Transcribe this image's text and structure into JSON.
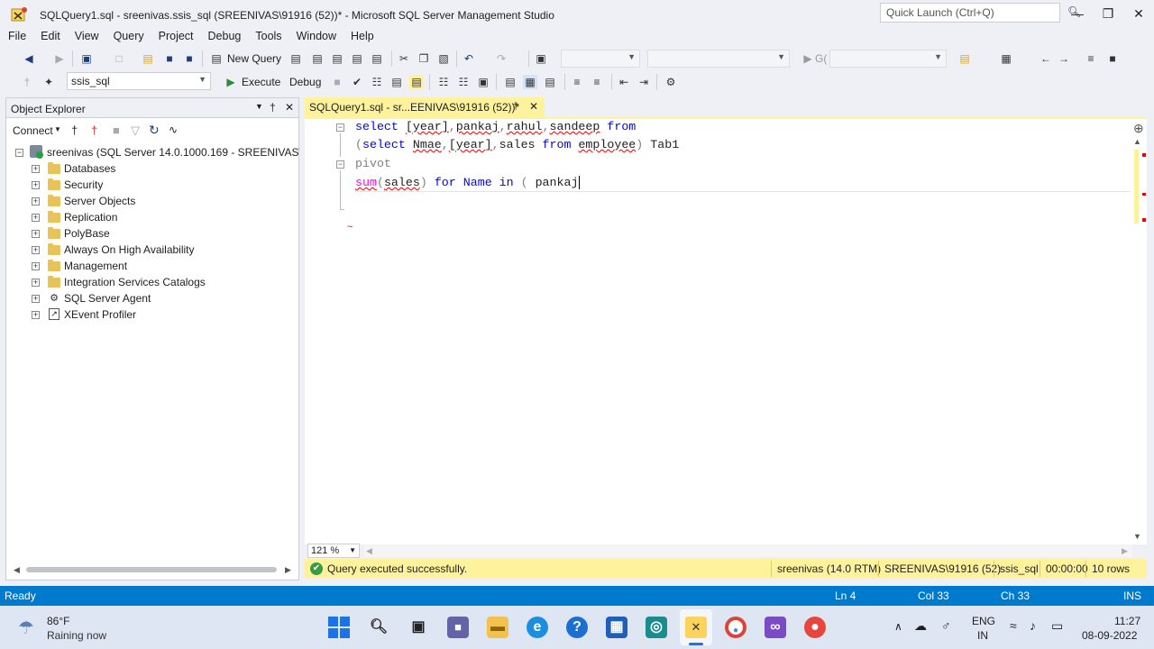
{
  "window": {
    "title": "SQLQuery1.sql - sreenivas.ssis_sql (SREENIVAS\\91916 (52))* - Microsoft SQL Server Management Studio",
    "quick_launch_placeholder": "Quick Launch (Ctrl+Q)"
  },
  "menu": [
    "File",
    "Edit",
    "View",
    "Query",
    "Project",
    "Debug",
    "Tools",
    "Window",
    "Help"
  ],
  "toolbar1": {
    "new_query": "New Query",
    "go_label": "G("
  },
  "toolbar2": {
    "database": "ssis_sql",
    "execute": "Execute",
    "debug": "Debug"
  },
  "object_explorer": {
    "title": "Object Explorer",
    "connect": "Connect",
    "server": "sreenivas (SQL Server 14.0.1000.169 - SREENIVAS\\919",
    "nodes": [
      "Databases",
      "Security",
      "Server Objects",
      "Replication",
      "PolyBase",
      "Always On High Availability",
      "Management",
      "Integration Services Catalogs",
      "SQL Server Agent",
      "XEvent Profiler"
    ]
  },
  "editor": {
    "tab_label": "SQLQuery1.sql - sr...EENIVAS\\91916 (52))*",
    "zoom": "121 %"
  },
  "query_status": {
    "message": "Query executed successfully.",
    "server": "sreenivas (14.0 RTM)",
    "user": "SREENIVAS\\91916 (52)",
    "database": "ssis_sql",
    "time": "00:00:00",
    "rows": "10 rows"
  },
  "statusbar": {
    "state": "Ready",
    "ln": "Ln 4",
    "col": "Col 33",
    "ch": "Ch 33",
    "mode": "INS"
  },
  "taskbar": {
    "weather_temp": "86°F",
    "weather_text": "Raining now",
    "lang1": "ENG",
    "lang2": "IN",
    "time": "11:27",
    "date": "08-09-2022"
  },
  "colors": {
    "accent": "#007acc",
    "tab_highlight": "#fff29d",
    "keyword": "#0000ff",
    "function": "#ff00ff"
  }
}
